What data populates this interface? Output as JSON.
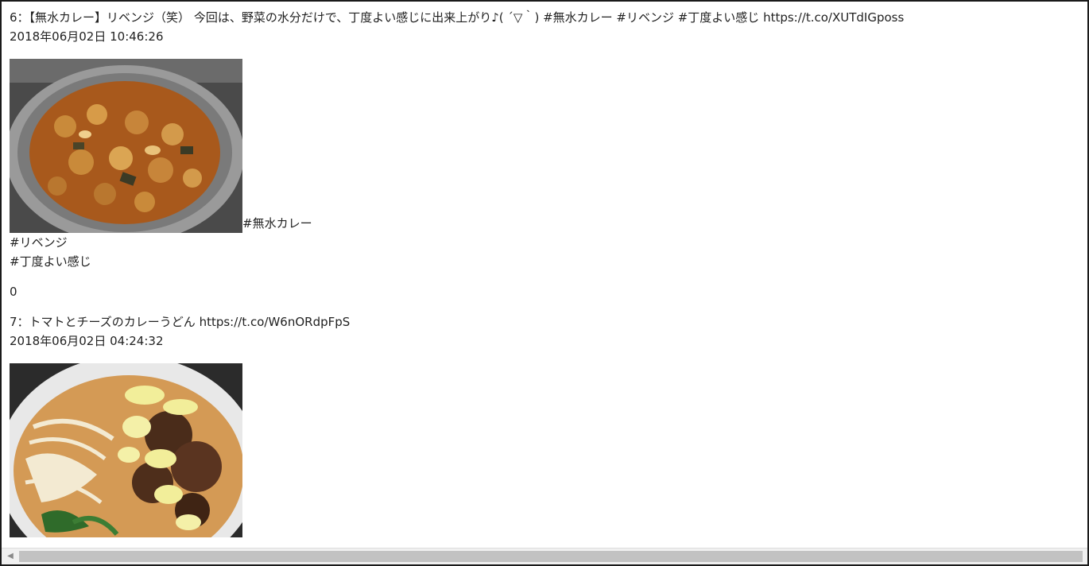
{
  "posts": [
    {
      "text": "6：【無水カレー】リベンジ（笑） 今回は、野菜の水分だけで、丁度よい感じに出来上がり♪( ´▽｀) #無水カレー #リベンジ #丁度よい感じ https://t.co/XUTdIGposs",
      "date": "2018年06月02日 10:46:26",
      "hashtags": [
        "#無水カレー",
        "#リベンジ",
        "#丁度よい感じ"
      ],
      "count": "0"
    },
    {
      "text": "7：トマトとチーズのカレーうどん https://t.co/W6nORdpFpS",
      "date": "2018年06月02日 04:24:32"
    }
  ],
  "scrollbar": {
    "left_arrow_icon": "arrow-left-icon"
  }
}
